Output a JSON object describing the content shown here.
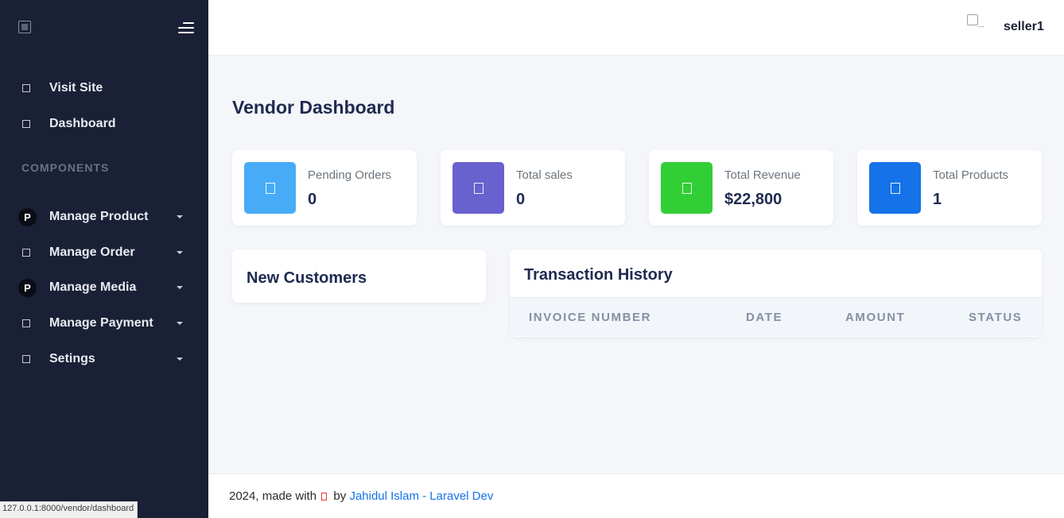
{
  "sidebar": {
    "nav": [
      {
        "label": "Visit Site",
        "icon": "square-outline-icon",
        "has_caret": false
      },
      {
        "label": "Dashboard",
        "icon": "square-outline-icon",
        "has_caret": false
      }
    ],
    "section_title": "COMPONENTS",
    "components": [
      {
        "label": "Manage Product",
        "icon": "circle-p-icon",
        "badge": "P",
        "has_caret": true
      },
      {
        "label": "Manage Order",
        "icon": "square-outline-icon",
        "has_caret": true
      },
      {
        "label": "Manage Media",
        "icon": "circle-p-icon",
        "badge": "P",
        "has_caret": true
      },
      {
        "label": "Manage Payment",
        "icon": "square-outline-icon",
        "has_caret": true
      },
      {
        "label": "Setings",
        "icon": "square-outline-icon",
        "has_caret": true
      }
    ]
  },
  "topbar": {
    "avatar_alt": "...",
    "username": "seller1"
  },
  "main": {
    "title": "Vendor Dashboard",
    "stats": [
      {
        "label": "Pending Orders",
        "value": "0",
        "color": "#48abf7"
      },
      {
        "label": "Total sales",
        "value": "0",
        "color": "#6861ce"
      },
      {
        "label": "Total Revenue",
        "value": "$22,800",
        "color": "#31ce36"
      },
      {
        "label": "Total Products",
        "value": "1",
        "color": "#1572e8"
      }
    ],
    "new_customers": {
      "title": "New Customers"
    },
    "transactions": {
      "title": "Transaction History",
      "columns": [
        "Invoice Number",
        "Date",
        "Amount",
        "Status"
      ]
    }
  },
  "footer": {
    "prefix": "2024, made with",
    "by": "by",
    "link_text": "Jahidul Islam - Laravel Dev",
    "heart_color": "#e53935"
  },
  "status_bar": {
    "url": "127.0.0.1:8000/vendor/dashboard"
  }
}
